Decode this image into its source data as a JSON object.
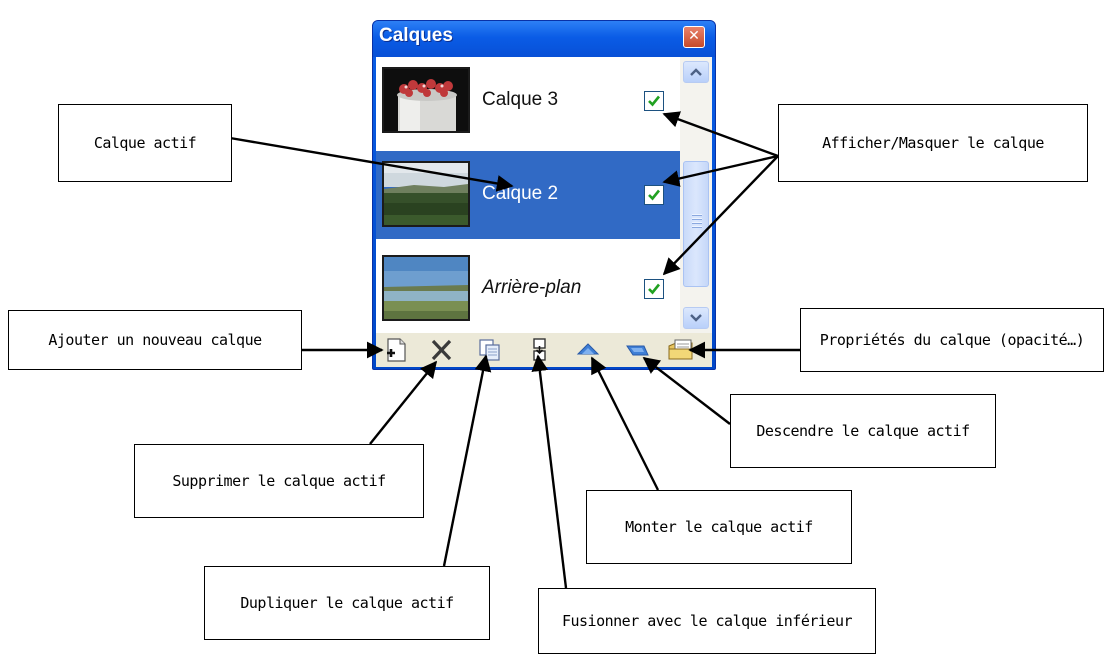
{
  "panel": {
    "title": "Calques",
    "close_glyph": "✕",
    "layers": [
      {
        "name": "Calque 3",
        "visible": true,
        "active": false,
        "thumbnail": "cake-thumbnail"
      },
      {
        "name": "Calque 2",
        "visible": true,
        "active": true,
        "thumbnail": "field-landscape-thumbnail"
      },
      {
        "name": "Arrière-plan",
        "visible": true,
        "active": false,
        "thumbnail": "lake-landscape-thumbnail"
      }
    ],
    "toolbar_icons": [
      "add-layer-icon",
      "delete-layer-icon",
      "duplicate-layer-icon",
      "merge-down-icon",
      "move-up-icon",
      "move-down-icon",
      "layer-properties-icon"
    ],
    "colors": {
      "titlebar": "#0a5ce6",
      "selection": "#316ac5",
      "toolbar": "#ece9d8"
    }
  },
  "callouts": {
    "calque_actif": "Calque actif",
    "afficher_masquer": "Afficher/Masquer le calque",
    "ajouter": "Ajouter un nouveau calque",
    "proprietes": "Propriétés du calque (opacité…)",
    "supprimer": "Supprimer le calque actif",
    "descendre": "Descendre le calque actif",
    "monter": "Monter le calque actif",
    "dupliquer": "Dupliquer le calque actif",
    "fusionner": "Fusionner avec le calque inférieur"
  }
}
